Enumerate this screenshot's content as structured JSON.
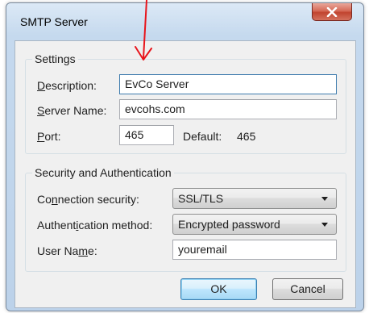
{
  "window": {
    "title": "SMTP Server"
  },
  "settings": {
    "group_label": "Settings",
    "description": {
      "label_pre": "",
      "label_acc": "D",
      "label_post": "escription:",
      "value": "EvCo Server"
    },
    "server_name": {
      "label_pre": "",
      "label_acc": "S",
      "label_post": "erver Name:",
      "value": "evcohs.com"
    },
    "port": {
      "label_pre": "",
      "label_acc": "P",
      "label_post": "ort:",
      "value": "465",
      "default_label": "Default:",
      "default_value": "465"
    }
  },
  "security": {
    "group_label": "Security and Authentication",
    "connection_security": {
      "label_pre": "Co",
      "label_acc": "n",
      "label_post": "nection security:",
      "value": "SSL/TLS"
    },
    "auth_method": {
      "label_pre": "Authent",
      "label_acc": "i",
      "label_post": "cation method:",
      "value": "Encrypted password"
    },
    "user_name": {
      "label_pre": "User Na",
      "label_acc": "m",
      "label_post": "e:",
      "value": "youremail"
    }
  },
  "buttons": {
    "ok": "OK",
    "cancel": "Cancel"
  },
  "colors": {
    "annotation_arrow": "#e8141b",
    "close_button": "#c1442f",
    "focus_border": "#3d7bad"
  },
  "icons": {
    "close": "close-x-icon",
    "dropdown": "chevron-down-icon",
    "annotation": "red-arrow-icon"
  }
}
